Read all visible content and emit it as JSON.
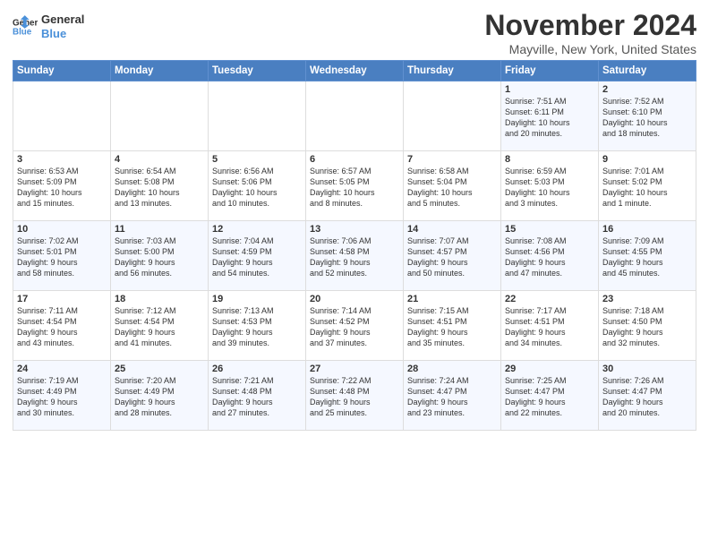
{
  "header": {
    "logo_line1": "General",
    "logo_line2": "Blue",
    "month": "November 2024",
    "location": "Mayville, New York, United States"
  },
  "weekdays": [
    "Sunday",
    "Monday",
    "Tuesday",
    "Wednesday",
    "Thursday",
    "Friday",
    "Saturday"
  ],
  "weeks": [
    [
      {
        "day": "",
        "info": ""
      },
      {
        "day": "",
        "info": ""
      },
      {
        "day": "",
        "info": ""
      },
      {
        "day": "",
        "info": ""
      },
      {
        "day": "",
        "info": ""
      },
      {
        "day": "1",
        "info": "Sunrise: 7:51 AM\nSunset: 6:11 PM\nDaylight: 10 hours\nand 20 minutes."
      },
      {
        "day": "2",
        "info": "Sunrise: 7:52 AM\nSunset: 6:10 PM\nDaylight: 10 hours\nand 18 minutes."
      }
    ],
    [
      {
        "day": "3",
        "info": "Sunrise: 6:53 AM\nSunset: 5:09 PM\nDaylight: 10 hours\nand 15 minutes."
      },
      {
        "day": "4",
        "info": "Sunrise: 6:54 AM\nSunset: 5:08 PM\nDaylight: 10 hours\nand 13 minutes."
      },
      {
        "day": "5",
        "info": "Sunrise: 6:56 AM\nSunset: 5:06 PM\nDaylight: 10 hours\nand 10 minutes."
      },
      {
        "day": "6",
        "info": "Sunrise: 6:57 AM\nSunset: 5:05 PM\nDaylight: 10 hours\nand 8 minutes."
      },
      {
        "day": "7",
        "info": "Sunrise: 6:58 AM\nSunset: 5:04 PM\nDaylight: 10 hours\nand 5 minutes."
      },
      {
        "day": "8",
        "info": "Sunrise: 6:59 AM\nSunset: 5:03 PM\nDaylight: 10 hours\nand 3 minutes."
      },
      {
        "day": "9",
        "info": "Sunrise: 7:01 AM\nSunset: 5:02 PM\nDaylight: 10 hours\nand 1 minute."
      }
    ],
    [
      {
        "day": "10",
        "info": "Sunrise: 7:02 AM\nSunset: 5:01 PM\nDaylight: 9 hours\nand 58 minutes."
      },
      {
        "day": "11",
        "info": "Sunrise: 7:03 AM\nSunset: 5:00 PM\nDaylight: 9 hours\nand 56 minutes."
      },
      {
        "day": "12",
        "info": "Sunrise: 7:04 AM\nSunset: 4:59 PM\nDaylight: 9 hours\nand 54 minutes."
      },
      {
        "day": "13",
        "info": "Sunrise: 7:06 AM\nSunset: 4:58 PM\nDaylight: 9 hours\nand 52 minutes."
      },
      {
        "day": "14",
        "info": "Sunrise: 7:07 AM\nSunset: 4:57 PM\nDaylight: 9 hours\nand 50 minutes."
      },
      {
        "day": "15",
        "info": "Sunrise: 7:08 AM\nSunset: 4:56 PM\nDaylight: 9 hours\nand 47 minutes."
      },
      {
        "day": "16",
        "info": "Sunrise: 7:09 AM\nSunset: 4:55 PM\nDaylight: 9 hours\nand 45 minutes."
      }
    ],
    [
      {
        "day": "17",
        "info": "Sunrise: 7:11 AM\nSunset: 4:54 PM\nDaylight: 9 hours\nand 43 minutes."
      },
      {
        "day": "18",
        "info": "Sunrise: 7:12 AM\nSunset: 4:54 PM\nDaylight: 9 hours\nand 41 minutes."
      },
      {
        "day": "19",
        "info": "Sunrise: 7:13 AM\nSunset: 4:53 PM\nDaylight: 9 hours\nand 39 minutes."
      },
      {
        "day": "20",
        "info": "Sunrise: 7:14 AM\nSunset: 4:52 PM\nDaylight: 9 hours\nand 37 minutes."
      },
      {
        "day": "21",
        "info": "Sunrise: 7:15 AM\nSunset: 4:51 PM\nDaylight: 9 hours\nand 35 minutes."
      },
      {
        "day": "22",
        "info": "Sunrise: 7:17 AM\nSunset: 4:51 PM\nDaylight: 9 hours\nand 34 minutes."
      },
      {
        "day": "23",
        "info": "Sunrise: 7:18 AM\nSunset: 4:50 PM\nDaylight: 9 hours\nand 32 minutes."
      }
    ],
    [
      {
        "day": "24",
        "info": "Sunrise: 7:19 AM\nSunset: 4:49 PM\nDaylight: 9 hours\nand 30 minutes."
      },
      {
        "day": "25",
        "info": "Sunrise: 7:20 AM\nSunset: 4:49 PM\nDaylight: 9 hours\nand 28 minutes."
      },
      {
        "day": "26",
        "info": "Sunrise: 7:21 AM\nSunset: 4:48 PM\nDaylight: 9 hours\nand 27 minutes."
      },
      {
        "day": "27",
        "info": "Sunrise: 7:22 AM\nSunset: 4:48 PM\nDaylight: 9 hours\nand 25 minutes."
      },
      {
        "day": "28",
        "info": "Sunrise: 7:24 AM\nSunset: 4:47 PM\nDaylight: 9 hours\nand 23 minutes."
      },
      {
        "day": "29",
        "info": "Sunrise: 7:25 AM\nSunset: 4:47 PM\nDaylight: 9 hours\nand 22 minutes."
      },
      {
        "day": "30",
        "info": "Sunrise: 7:26 AM\nSunset: 4:47 PM\nDaylight: 9 hours\nand 20 minutes."
      }
    ]
  ]
}
